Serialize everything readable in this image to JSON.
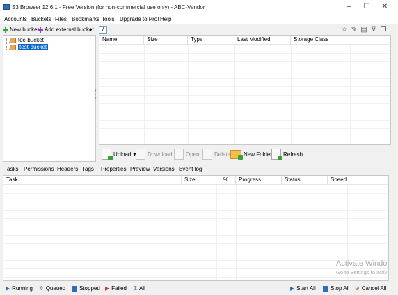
{
  "window": {
    "title": "S3 Browser 12.6.1 - Free Version (for non-commercial use only) - ABC-Vendor",
    "minimize": "–",
    "maximize": "☐",
    "close": "✕"
  },
  "menu": [
    "Accounts",
    "Buckets",
    "Files",
    "Bookmarks",
    "Tools",
    "Upgrade to Pro!",
    "Help"
  ],
  "left_toolbar": {
    "new_bucket": "New bucket",
    "add_external": "Add external bucket",
    "dropdown_icon": "chevron-down-icon"
  },
  "tree": {
    "items": [
      {
        "label": "tdc-bucket",
        "selected": false
      },
      {
        "label": "test-bucket",
        "selected": true
      }
    ]
  },
  "path": {
    "value": "/"
  },
  "path_icons": [
    "star-icon",
    "pencil-icon",
    "columns-icon",
    "filter-icon",
    "copy-icon"
  ],
  "file_columns": [
    "Name",
    "Size",
    "Type",
    "Last Modified",
    "Storage Class"
  ],
  "actions": [
    {
      "label": "Upload",
      "enabled": true,
      "dropdown": "▾"
    },
    {
      "label": "Download",
      "enabled": false
    },
    {
      "label": "Open",
      "enabled": false
    },
    {
      "label": "Delete",
      "enabled": false
    },
    {
      "label": "New Folder",
      "enabled": true
    },
    {
      "label": "Refresh",
      "enabled": true
    }
  ],
  "tabs": [
    "Tasks",
    "Permissions",
    "Headers",
    "Tags",
    "Properties",
    "Preview",
    "Versions",
    "Event log"
  ],
  "task_columns": [
    "Task",
    "Size",
    "%",
    "Progress",
    "Status",
    "Speed"
  ],
  "status_filters": [
    "Running",
    "Queued",
    "Stopped",
    "Failed",
    "All"
  ],
  "status_actions": [
    "Start All",
    "Stop All",
    "Cancel All"
  ],
  "watermark": {
    "line1": "Activate Windo",
    "line2": "Go to Settings to activ"
  },
  "colors": {
    "selection": "#0a64c8",
    "bucket": "#e8a45a",
    "add_green": "#3aa13a"
  }
}
